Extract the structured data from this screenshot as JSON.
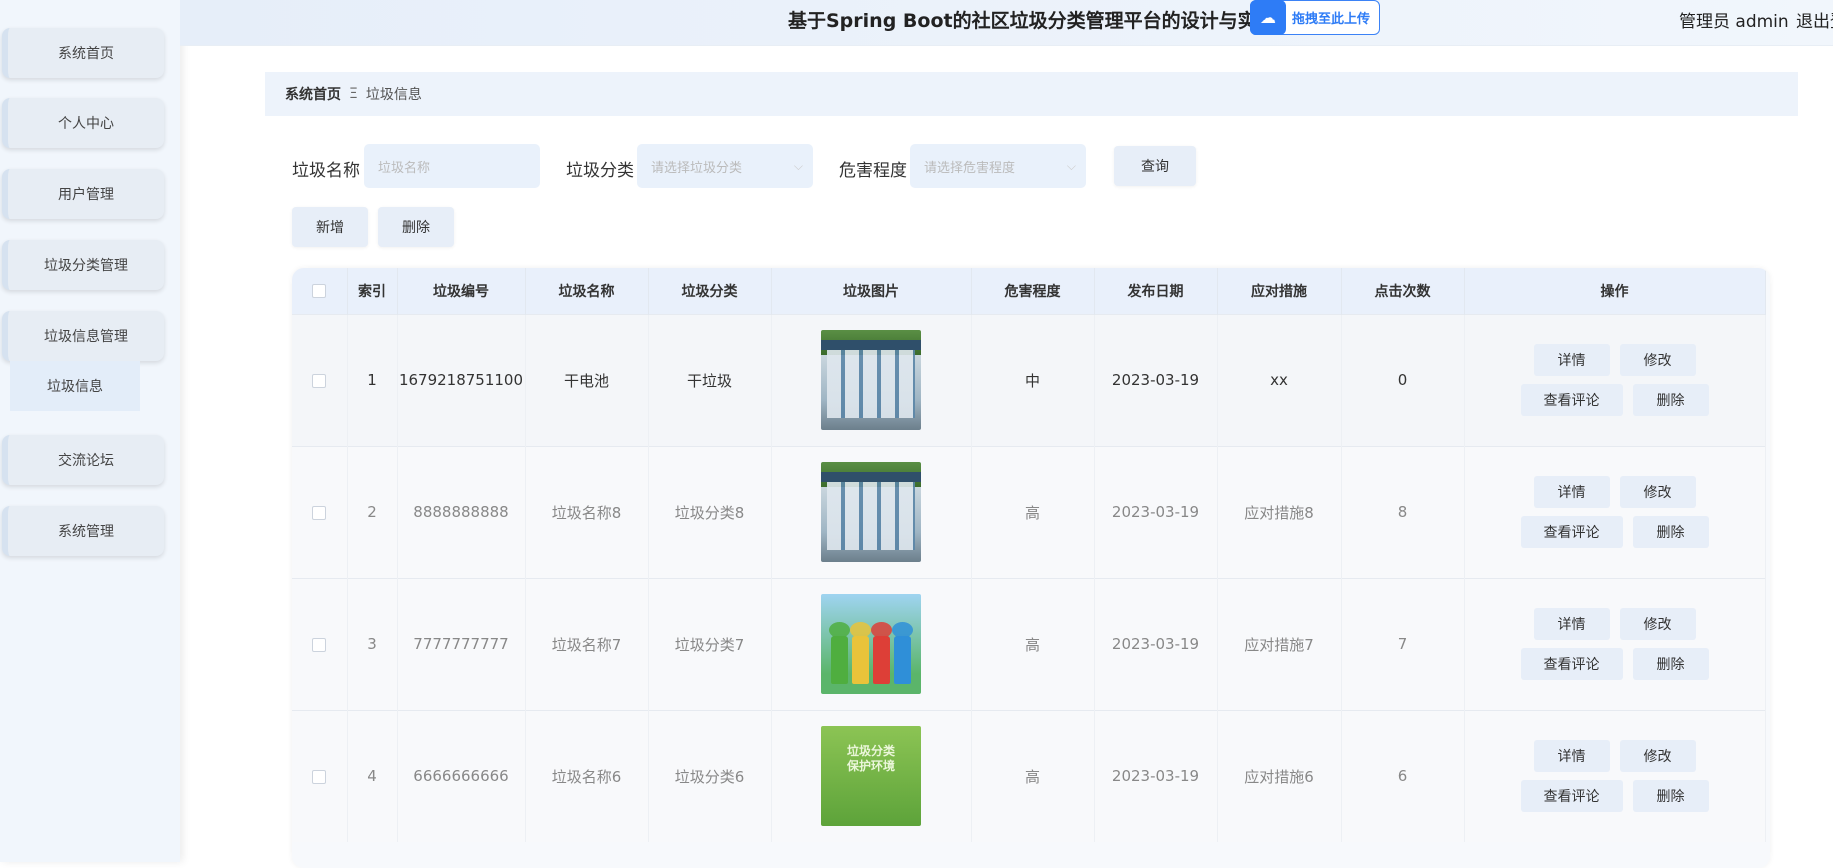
{
  "header": {
    "title": "基于Spring Boot的社区垃圾分类管理平台的设计与实现",
    "upload_label": "拖拽至此上传",
    "user_label": "管理员 admin",
    "logout_label": "退出登录"
  },
  "sidebar": {
    "items": [
      {
        "label": "系统首页"
      },
      {
        "label": "个人中心"
      },
      {
        "label": "用户管理"
      },
      {
        "label": "垃圾分类管理"
      },
      {
        "label": "垃圾信息管理"
      },
      {
        "label": "交流论坛"
      },
      {
        "label": "系统管理"
      }
    ],
    "sub_item": "垃圾信息"
  },
  "breadcrumb": {
    "home": "系统首页",
    "separator": "Ξ",
    "current": "垃圾信息"
  },
  "search": {
    "name_label": "垃圾名称",
    "name_placeholder": "垃圾名称",
    "category_label": "垃圾分类",
    "category_placeholder": "请选择垃圾分类",
    "hazard_label": "危害程度",
    "hazard_placeholder": "请选择危害程度",
    "query_button": "查询"
  },
  "actions": {
    "add": "新增",
    "delete": "删除"
  },
  "table": {
    "columns": [
      "索引",
      "垃圾编号",
      "垃圾名称",
      "垃圾分类",
      "垃圾图片",
      "危害程度",
      "发布日期",
      "应对措施",
      "点击次数",
      "操作"
    ],
    "row_ops": {
      "detail": "详情",
      "edit": "修改",
      "comments": "查看评论",
      "delete": "删除"
    },
    "rows": [
      {
        "index": "1",
        "code": "1679218751100",
        "name": "干电池",
        "category": "干垃圾",
        "image": "station",
        "hazard": "中",
        "date": "2023-03-19",
        "measure": "xx",
        "clicks": "0"
      },
      {
        "index": "2",
        "code": "8888888888",
        "name": "垃圾名称8",
        "category": "垃圾分类8",
        "image": "station",
        "hazard": "高",
        "date": "2023-03-19",
        "measure": "应对措施8",
        "clicks": "8"
      },
      {
        "index": "3",
        "code": "7777777777",
        "name": "垃圾名称7",
        "category": "垃圾分类7",
        "image": "bins",
        "hazard": "高",
        "date": "2023-03-19",
        "measure": "应对措施7",
        "clicks": "7"
      },
      {
        "index": "4",
        "code": "6666666666",
        "name": "垃圾名称6",
        "category": "垃圾分类6",
        "image": "poster",
        "hazard": "高",
        "date": "2023-03-19",
        "measure": "应对措施6",
        "clicks": "6"
      }
    ],
    "poster_text": [
      "垃圾分类",
      "保护环境"
    ]
  },
  "colors": {
    "accent": "#2e7cf6",
    "panel": "#e7eef8",
    "bin_colors": [
      "#4fae3f",
      "#e9c33a",
      "#dd3f37",
      "#2f8fd8"
    ]
  }
}
